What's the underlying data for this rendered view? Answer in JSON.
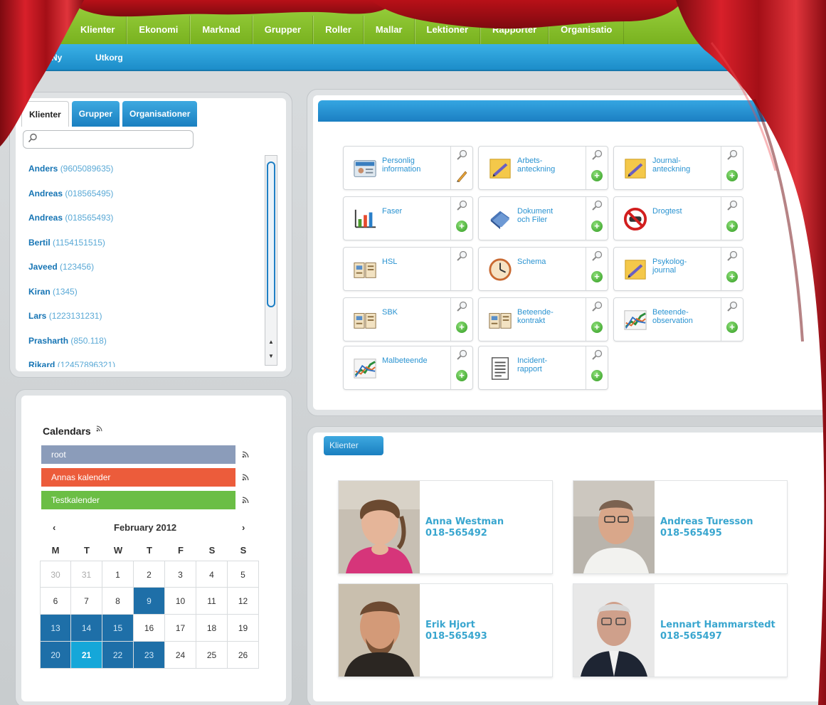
{
  "top_nav": {
    "items": [
      "Klienter",
      "Ekonomi",
      "Marknad",
      "Grupper",
      "Roller",
      "Mallar",
      "Lektioner",
      "Rapporter",
      "Organisatio"
    ]
  },
  "sub_nav": {
    "items": [
      "Ny",
      "Utkorg"
    ]
  },
  "client_panel": {
    "tabs": [
      "Klienter",
      "Grupper",
      "Organisationer"
    ],
    "search_placeholder": "",
    "clients": [
      {
        "name": "Anders",
        "id": "(9605089635)"
      },
      {
        "name": "Andreas",
        "id": "(018565495)"
      },
      {
        "name": "Andreas",
        "id": "(018565493)"
      },
      {
        "name": "Bertil",
        "id": "(1154151515)"
      },
      {
        "name": "Javeed",
        "id": "(123456)"
      },
      {
        "name": "Kiran",
        "id": "(1345)"
      },
      {
        "name": "Lars",
        "id": "(1223131231)"
      },
      {
        "name": "Prasharth",
        "id": "(850.118)"
      },
      {
        "name": "Rikard",
        "id": "(12457896321)"
      }
    ]
  },
  "actions": {
    "tiles": [
      {
        "label": "Personlig\ninformation",
        "icon": "id-card-icon",
        "has_add": false,
        "has_edit": true
      },
      {
        "label": "Arbets-\nanteckning",
        "icon": "notepad-icon",
        "has_add": true
      },
      {
        "label": "Journal-\nanteckning",
        "icon": "notepad-icon",
        "has_add": true
      },
      {
        "label": "Faser",
        "icon": "bar-chart-icon",
        "has_add": true
      },
      {
        "label": "Dokument\noch Filer",
        "icon": "books-icon",
        "has_add": true
      },
      {
        "label": "Drogtest",
        "icon": "no-drugs-icon",
        "has_add": true
      },
      {
        "label": "HSL",
        "icon": "book-icon",
        "has_add": false
      },
      {
        "label": "Schema",
        "icon": "clock-icon",
        "has_add": true
      },
      {
        "label": "Psykolog-\njournal",
        "icon": "notepad-icon",
        "has_add": true
      },
      {
        "label": "SBK",
        "icon": "book-icon",
        "has_add": true
      },
      {
        "label": "Beteende-\nkontrakt",
        "icon": "book-icon",
        "has_add": true
      },
      {
        "label": "Beteende-\nobservation",
        "icon": "trend-chart-icon",
        "has_add": true
      },
      {
        "label": "Malbeteende",
        "icon": "trend-chart-icon",
        "has_add": true
      },
      {
        "label": "Incident-\nrapport",
        "icon": "document-icon",
        "has_add": true
      }
    ]
  },
  "calendars": {
    "title": "Calendars",
    "list": [
      {
        "label": "root",
        "color": "#8b9cba"
      },
      {
        "label": "Annas kalender",
        "color": "#ec5c3b"
      },
      {
        "label": "Testkalender",
        "color": "#6bbe45"
      }
    ],
    "month_label": "February 2012",
    "prev": "‹",
    "next": "›",
    "weekdays": [
      "M",
      "T",
      "W",
      "T",
      "F",
      "S",
      "S"
    ],
    "weeks": [
      [
        "30",
        "31",
        "1",
        "2",
        "3",
        "4",
        "5"
      ],
      [
        "6",
        "7",
        "8",
        "9",
        "10",
        "11",
        "12"
      ],
      [
        "13",
        "14",
        "15",
        "16",
        "17",
        "18",
        "19"
      ],
      [
        "20",
        "21",
        "22",
        "23",
        "24",
        "25",
        "26"
      ]
    ]
  },
  "contacts": {
    "tab_label": "Klienter",
    "people": [
      {
        "name": "Anna Westman",
        "phone": "018-565492"
      },
      {
        "name": "Andreas Turesson",
        "phone": "018-565495"
      },
      {
        "name": "Erik Hjort",
        "phone": "018-565493"
      },
      {
        "name": "Lennart Hammarstedt",
        "phone": "018-565497"
      }
    ]
  },
  "colors": {
    "nav_green": "#86c22c",
    "nav_blue": "#2a9fdb",
    "curtain_red": "#c8141c"
  }
}
